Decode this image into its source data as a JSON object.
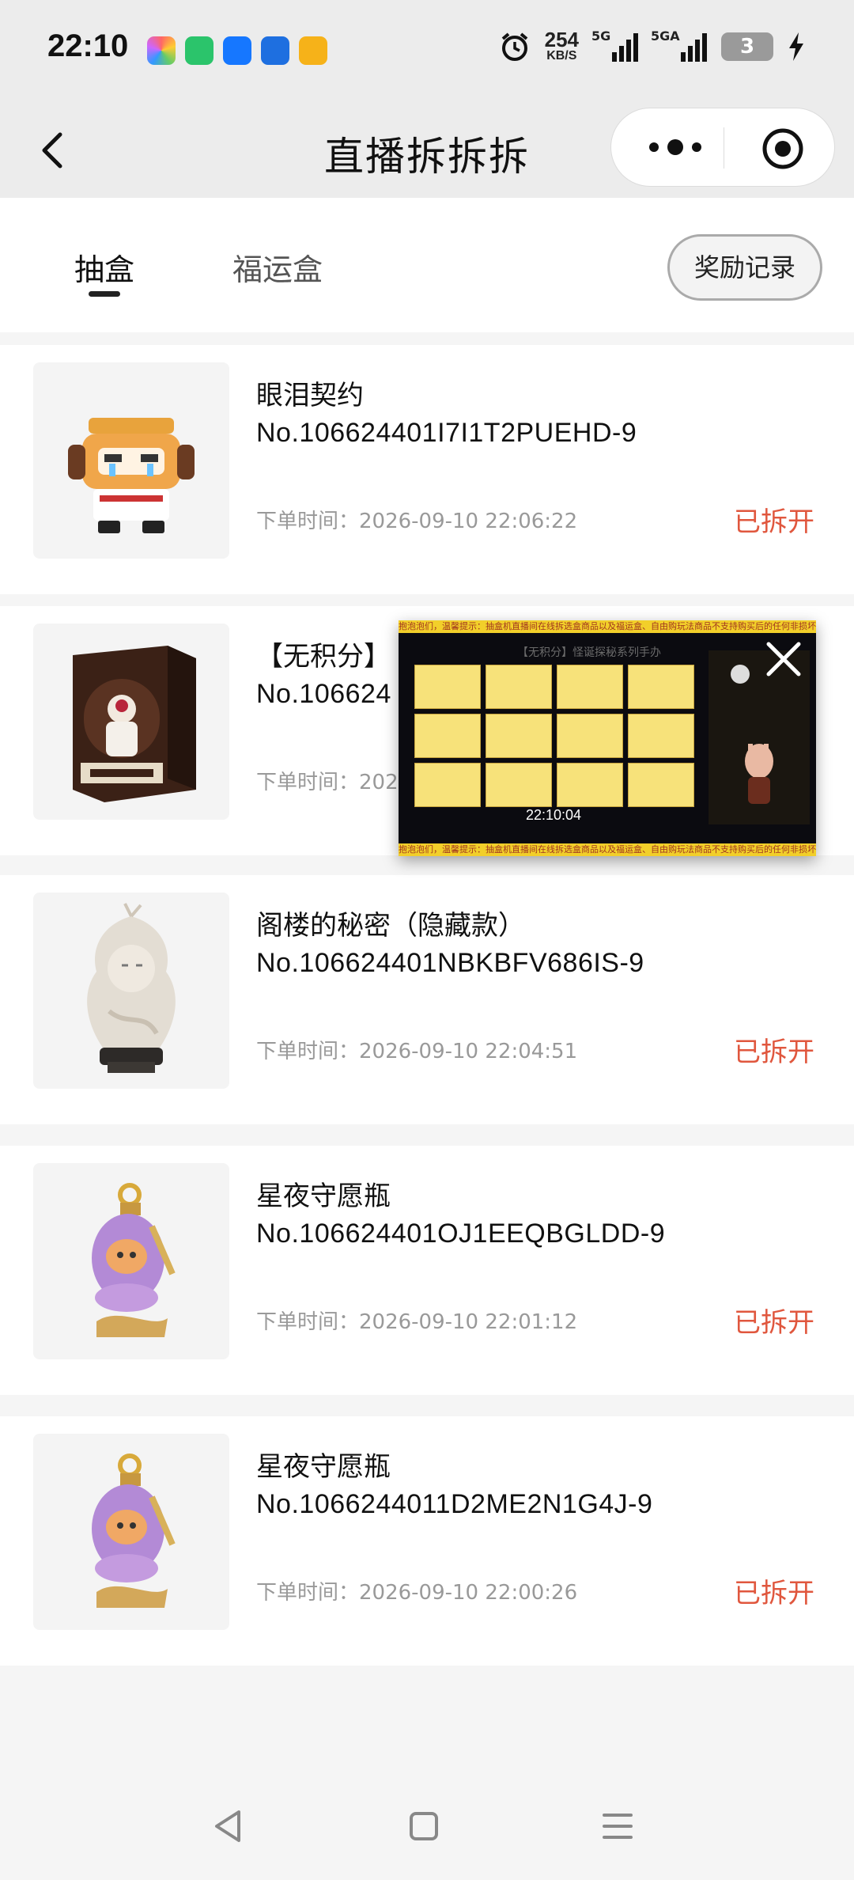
{
  "status_bar": {
    "time": "22:10",
    "speed_value": "254",
    "speed_unit": "KB/S",
    "signal1_label": "5G",
    "signal2_label": "5GA",
    "battery": "3"
  },
  "nav": {
    "title": "直播拆拆拆"
  },
  "tabs": {
    "items": [
      {
        "label": "抽盒"
      },
      {
        "label": "福运盒"
      }
    ],
    "reward_label": "奖励记录"
  },
  "orders": [
    {
      "name": "眼泪契约",
      "order_no": "No.106624401I7I1T2PUEHD-9",
      "time": "下单时间：2026-09-10 22:06:22",
      "status": "已拆开"
    },
    {
      "name": "【无积分】",
      "order_no": "No.106624",
      "time": "下单时间：202",
      "status": ""
    },
    {
      "name": "阁楼的秘密（隐藏款）",
      "order_no": "No.106624401NBKBFV686IS-9",
      "time": "下单时间：2026-09-10 22:04:51",
      "status": "已拆开"
    },
    {
      "name": "星夜守愿瓶",
      "order_no": "No.106624401OJ1EEQBGLDD-9",
      "time": "下单时间：2026-09-10 22:01:12",
      "status": "已拆开"
    },
    {
      "name": "星夜守愿瓶",
      "order_no": "No.1066244011D2ME2N1G4J-9",
      "time": "下单时间：2026-09-10 22:00:26",
      "status": "已拆开"
    }
  ],
  "float_video": {
    "ticker_text": "抱泡泡们，温馨提示：抽盒机直播间在线拆选盒商品以及福运盒、自由购玩法商品不支持购买后的任何非损坏问题退",
    "header_text": "【无积分】怪诞探秘系列手办",
    "timestamp": "22:10:04"
  }
}
